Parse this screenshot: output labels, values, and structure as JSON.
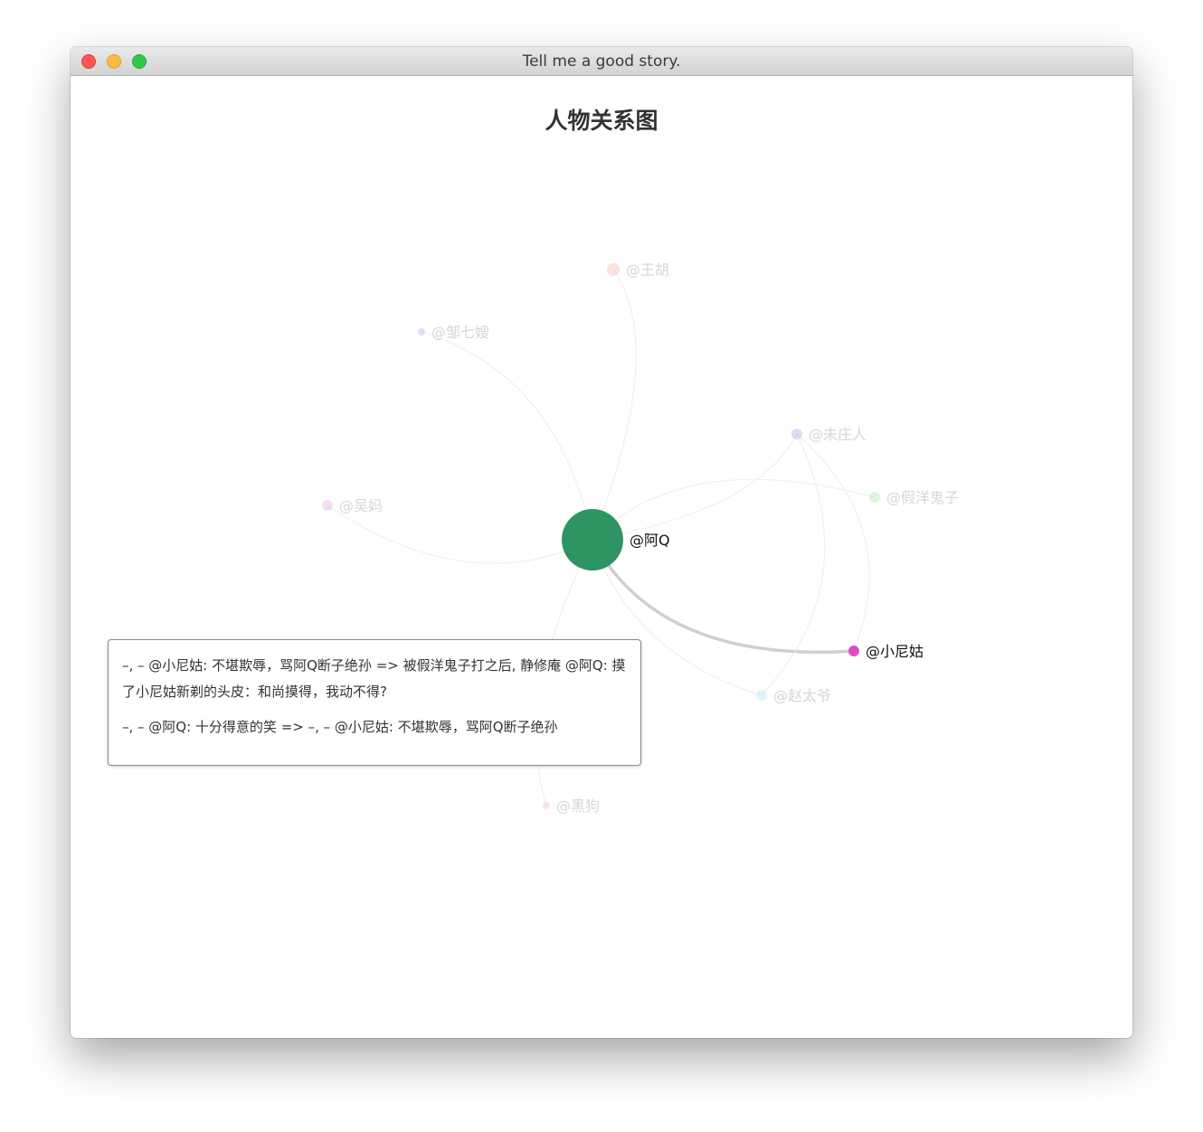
{
  "window": {
    "title": "Tell me a good story."
  },
  "chart_data": {
    "type": "graph",
    "title": "人物关系图",
    "nodes": [
      {
        "id": "aq",
        "name": "@阿Q",
        "color": "#2e9461",
        "size": 34,
        "highlighted": true
      },
      {
        "id": "xng",
        "name": "@小尼姑",
        "color": "#e14bc0",
        "size": 6,
        "highlighted": true
      },
      {
        "id": "wh",
        "name": "@王胡",
        "color": "#f7a8a4",
        "size": 7,
        "highlighted": false
      },
      {
        "id": "zqs",
        "name": "@邹七嫂",
        "color": "#a6a6ea",
        "size": 4,
        "highlighted": false
      },
      {
        "id": "wcr",
        "name": "@未庄人",
        "color": "#9e9ee8",
        "size": 6,
        "highlighted": false
      },
      {
        "id": "jygz",
        "name": "@假洋鬼子",
        "color": "#9fe29a",
        "size": 6,
        "highlighted": false
      },
      {
        "id": "wm",
        "name": "@吴妈",
        "color": "#d8a6d8",
        "size": 6,
        "highlighted": false
      },
      {
        "id": "zty",
        "name": "@赵太爷",
        "color": "#a6e0f2",
        "size": 6,
        "highlighted": false
      },
      {
        "id": "hg",
        "name": "@黑狗",
        "color": "#f7b1ab",
        "size": 4,
        "highlighted": false
      }
    ],
    "links": [
      {
        "source": "aq",
        "target": "xng",
        "highlighted": true
      },
      {
        "source": "aq",
        "target": "wh",
        "highlighted": false
      },
      {
        "source": "aq",
        "target": "zqs",
        "highlighted": false
      },
      {
        "source": "aq",
        "target": "wcr",
        "highlighted": false
      },
      {
        "source": "aq",
        "target": "jygz",
        "highlighted": false
      },
      {
        "source": "aq",
        "target": "wm",
        "highlighted": false
      },
      {
        "source": "aq",
        "target": "zty",
        "highlighted": false
      },
      {
        "source": "aq",
        "target": "hg",
        "highlighted": false
      },
      {
        "source": "wcr",
        "target": "xng",
        "highlighted": false
      },
      {
        "source": "wcr",
        "target": "zty",
        "highlighted": false
      }
    ]
  },
  "tooltip": {
    "lines": [
      "–, – @小尼姑: 不堪欺辱，骂阿Q断子绝孙 => 被假洋鬼子打之后, 静修庵 @阿Q: 摸了小尼姑新剃的头皮：和尚摸得，我动不得?",
      "–, – @阿Q: 十分得意的笑 => –, – @小尼姑: 不堪欺辱，骂阿Q断子绝孙"
    ]
  }
}
